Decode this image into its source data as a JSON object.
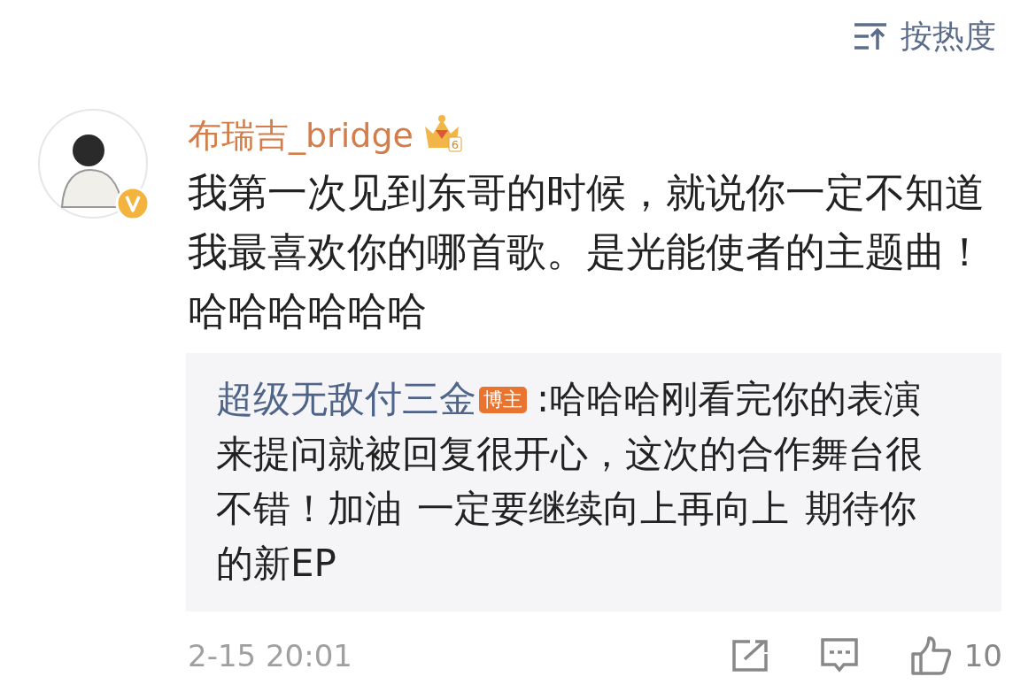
{
  "sort": {
    "label": "按热度"
  },
  "comment": {
    "author": "布瑞吉_bridge",
    "verified": true,
    "crown_level": "6",
    "text": "我第一次见到东哥的时候，就说你一定不知道我最喜欢你的哪首歌。是光能使者的主题曲！哈哈哈哈哈哈"
  },
  "reply": {
    "author": "超级无敌付三金",
    "badge": "博主",
    "text": ":哈哈哈刚看完你的表演来提问就被回复很开心，这次的合作舞台很不错！加油 一定要继续向上再向上 期待你的新EP"
  },
  "footer": {
    "time": "2-15 20:01",
    "likes": "10"
  }
}
